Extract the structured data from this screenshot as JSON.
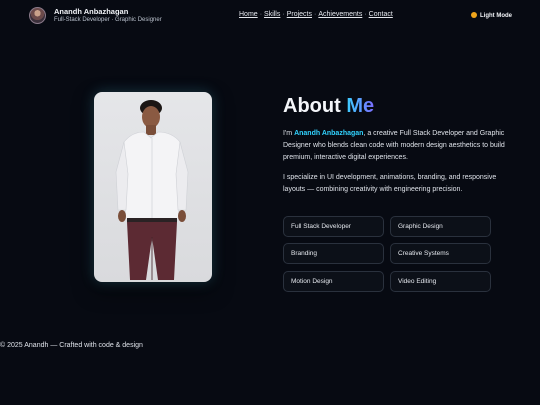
{
  "header": {
    "name": "Anandh Anbazhagan",
    "subtitle": "Full-Stack Developer · Graphic Designer",
    "nav": [
      "Home",
      "Skills",
      "Projects",
      "Achievements",
      "Contact"
    ],
    "nav_separator": "·",
    "theme_toggle": "Light Mode"
  },
  "about": {
    "title_start": "About",
    "title_accent": "Me",
    "intro_prefix": "I'm",
    "intro_name": "Anandh Anbazhagan",
    "intro_rest": ", a creative Full Stack Developer and Graphic Designer who blends clean code with modern design aesthetics to build premium, interactive digital experiences.",
    "para2": "I specialize in UI development, animations, branding, and responsive layouts — combining creativity with engineering precision.",
    "skills": [
      "Full Stack Developer",
      "Graphic Design",
      "Branding",
      "Creative Systems",
      "Motion Design",
      "Video Editing"
    ]
  },
  "footer": {
    "text": "© 2025 Anandh — Crafted with code & design"
  },
  "colors": {
    "background": "#070a12",
    "accent_cyan": "#31d3ff",
    "accent_violet": "#7b6cff",
    "toggle_dot": "#f0a51b"
  }
}
